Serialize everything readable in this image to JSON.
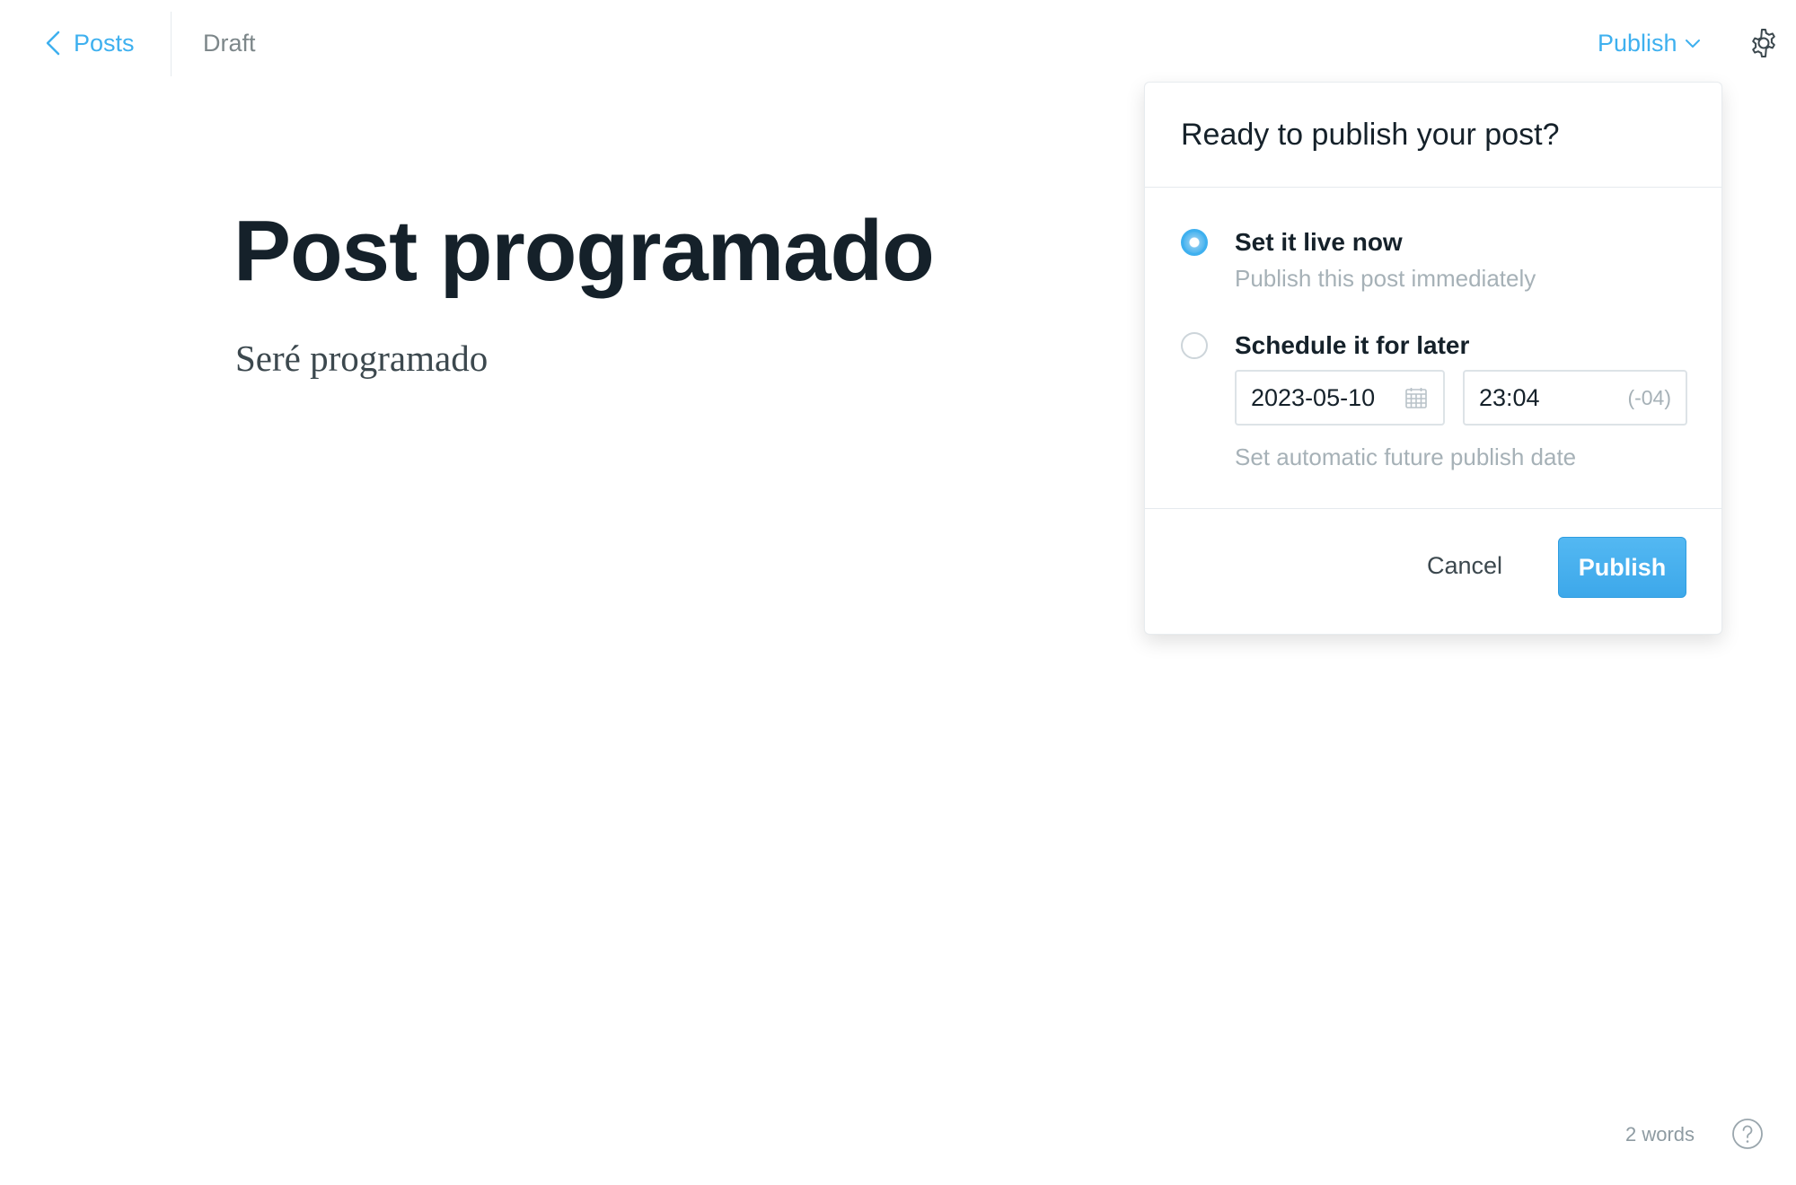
{
  "header": {
    "back_label": "Posts",
    "status": "Draft",
    "publish_menu_label": "Publish"
  },
  "editor": {
    "title": "Post programado",
    "body": "Seré programado"
  },
  "publish_popover": {
    "title": "Ready to publish your post?",
    "options": [
      {
        "label": "Set it live now",
        "description": "Publish this post immediately",
        "selected": true
      },
      {
        "label": "Schedule it for later",
        "description": "Set automatic future publish date",
        "selected": false
      }
    ],
    "date_value": "2023-05-10",
    "time_value": "23:04",
    "timezone": "(-04)",
    "cancel_label": "Cancel",
    "publish_label": "Publish"
  },
  "footer": {
    "word_count": "2 words"
  },
  "colors": {
    "accent": "#3eb0ef",
    "text": "#15212a",
    "muted": "#a6b1b7",
    "border": "#e5eaee"
  },
  "icons": [
    "chevron-left-icon",
    "chevron-down-icon",
    "gear-icon",
    "calendar-icon",
    "help-icon"
  ]
}
